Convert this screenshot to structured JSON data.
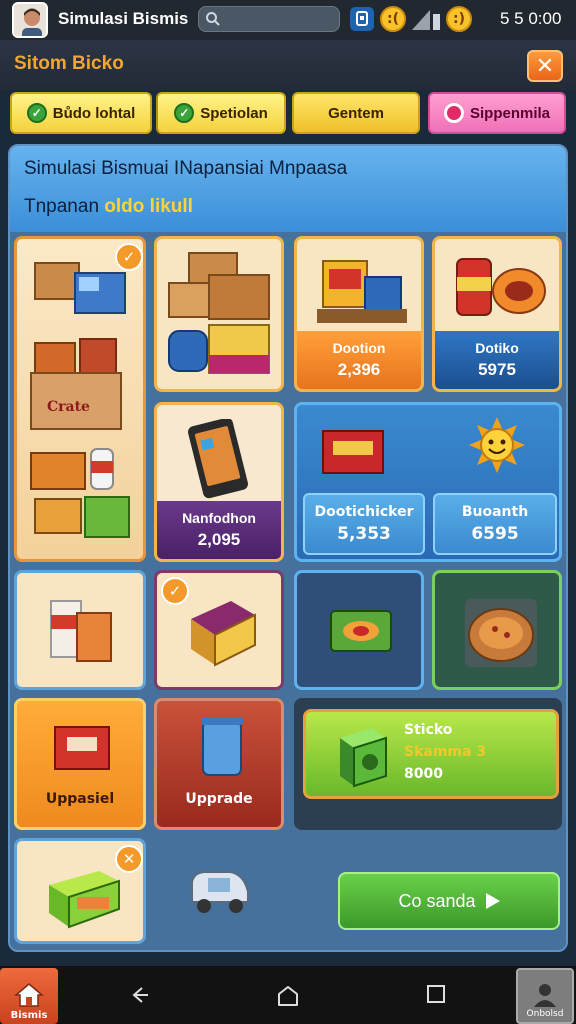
{
  "status_bar": {
    "title": "Simulasi Bismis",
    "time": "5 5 0:00",
    "emoji_left": ":(",
    "emoji_right": ":)"
  },
  "header": {
    "title": "Sitom Bicko",
    "close_label": "✕"
  },
  "tabs": [
    {
      "label": "Bůdo lohtal",
      "active": true
    },
    {
      "label": "Spetiolan"
    },
    {
      "label": "Gentem"
    },
    {
      "label": "Sippenmila"
    }
  ],
  "panel": {
    "title": "Simulasi Bismuai INapansiai Mnpaasa",
    "subtitle_prefix": "Tnpanan",
    "subtitle_highlight": "oldo likull"
  },
  "cards": {
    "food": {
      "label": "Dootion",
      "value": "2,396"
    },
    "drink": {
      "label": "Dotiko",
      "value": "5975"
    },
    "phone": {
      "label": "Nanfodhon",
      "value": "2,095"
    },
    "combo_a": {
      "label": "Dootichicker",
      "value": "5,353"
    },
    "combo_b": {
      "label": "Buoanth",
      "value": "6595"
    },
    "upgrade_a": {
      "label": "Uppasiel"
    },
    "upgrade_b": {
      "label": "Upprade"
    },
    "promo": {
      "line1": "Sticko",
      "line2": "Skamma 3",
      "line3": "8000"
    },
    "go_label": "Co sanda"
  },
  "nav": {
    "home_label": "Bismis",
    "profile_label": "Onbolsd"
  },
  "colors": {
    "accent_orange": "#f3a531",
    "panel_blue": "#3b8fd8",
    "go_green": "#4bb33a"
  }
}
